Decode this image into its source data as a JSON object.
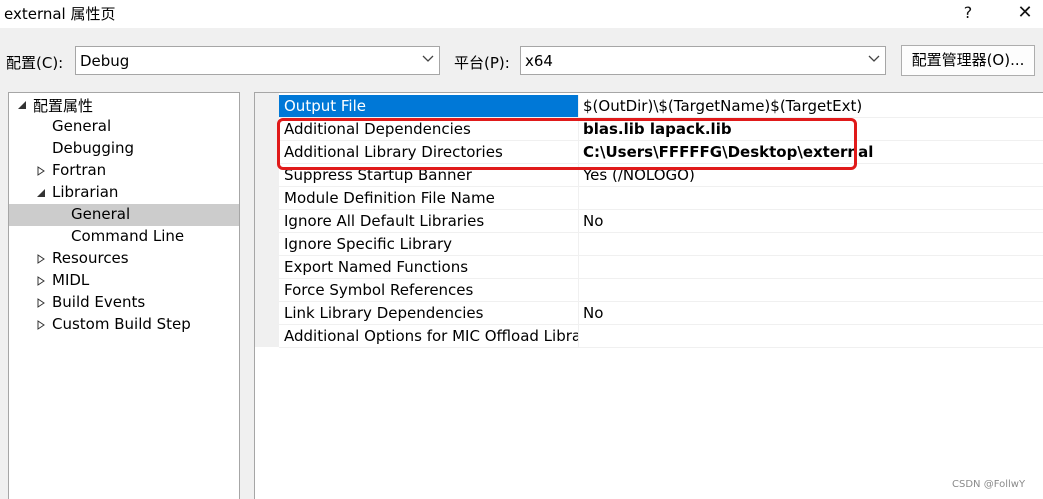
{
  "window": {
    "title": "external 属性页",
    "help_label": "?",
    "close_label": "✕"
  },
  "config_bar": {
    "config_label": "配置(C):",
    "config_value": "Debug",
    "platform_label": "平台(P):",
    "platform_value": "x64",
    "manager_button": "配置管理器(O)..."
  },
  "tree": {
    "items": [
      {
        "label": "配置属性",
        "arrow": "expanded"
      },
      {
        "label": "General",
        "arrow": "none"
      },
      {
        "label": "Debugging",
        "arrow": "none"
      },
      {
        "label": "Fortran",
        "arrow": "collapsed"
      },
      {
        "label": "Librarian",
        "arrow": "expanded"
      },
      {
        "label": "General",
        "arrow": "none",
        "selected": true
      },
      {
        "label": "Command Line",
        "arrow": "none"
      },
      {
        "label": "Resources",
        "arrow": "collapsed"
      },
      {
        "label": "MIDL",
        "arrow": "collapsed"
      },
      {
        "label": "Build Events",
        "arrow": "collapsed"
      },
      {
        "label": "Custom Build Step",
        "arrow": "collapsed"
      }
    ]
  },
  "properties": {
    "rows": [
      {
        "name": "Output File",
        "value": "$(OutDir)\\$(TargetName)$(TargetExt)",
        "selected": true
      },
      {
        "name": "Additional Dependencies",
        "value": "blas.lib lapack.lib",
        "bold": true
      },
      {
        "name": "Additional Library Directories",
        "value": "C:\\Users\\FFFFFG\\Desktop\\external",
        "bold": true
      },
      {
        "name": "Suppress Startup Banner",
        "value": "Yes (/NOLOGO)"
      },
      {
        "name": "Module Definition File Name",
        "value": ""
      },
      {
        "name": "Ignore All Default Libraries",
        "value": "No"
      },
      {
        "name": "Ignore Specific Library",
        "value": ""
      },
      {
        "name": "Export Named Functions",
        "value": ""
      },
      {
        "name": "Force Symbol References",
        "value": ""
      },
      {
        "name": "Link Library Dependencies",
        "value": "No"
      },
      {
        "name": "Additional Options for MIC Offload Libra",
        "value": ""
      }
    ]
  },
  "colors": {
    "selection_blue": "#0078d7",
    "highlight_red": "#e01a1a",
    "tree_selected": "#cccccc"
  },
  "watermark": "CSDN @FollwY"
}
